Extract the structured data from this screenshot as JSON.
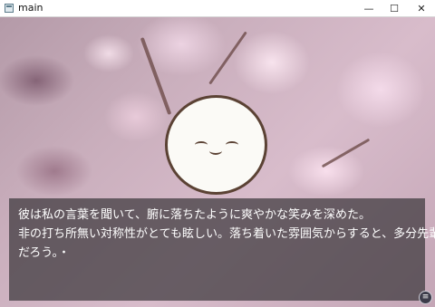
{
  "window": {
    "title": "main",
    "minimize_glyph": "—",
    "maximize_glyph": "☐",
    "close_glyph": "✕"
  },
  "dialog": {
    "lines": [
      "彼は私の言葉を聞いて、腑に落ちたように爽やかな笑みを深めた。",
      "非の打ち所無い対称性がとても眩しい。落ち着いた雰囲気からすると、多分先輩",
      "だろう。・"
    ]
  },
  "menu_button": {
    "glyph": "≡"
  },
  "colors": {
    "dialog_bg": "#3c383c",
    "face_outline": "#5b4234",
    "face_fill": "#fbfaf6",
    "text": "#ffffff"
  },
  "icons": {
    "app": "app-window-icon",
    "menu": "hamburger-menu-icon"
  }
}
